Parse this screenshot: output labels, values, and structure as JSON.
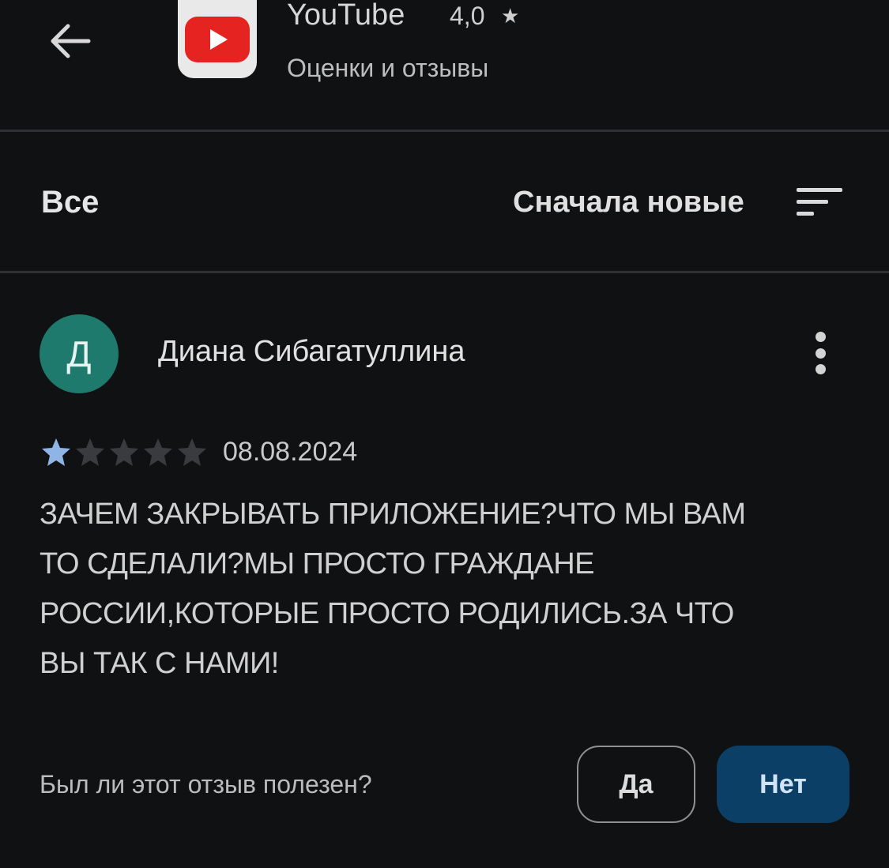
{
  "header": {
    "app_name": "YouTube",
    "rating": "4,0",
    "rating_star_glyph": "★",
    "subtitle": "Оценки и отзывы",
    "back_icon": "arrow-left-icon",
    "app_icon": "youtube-logo-icon"
  },
  "filters": {
    "all_label": "Все",
    "sort_label": "Сначала новые",
    "sort_icon": "sort-icon"
  },
  "review": {
    "avatar_letter": "Д",
    "author": "Диана Сибагатуллина",
    "rating": 1,
    "max_rating": 5,
    "date": "08.08.2024",
    "text": "ЗАЧЕМ ЗАКРЫВАТЬ ПРИЛОЖЕНИЕ?ЧТО МЫ ВАМ\nТО СДЕЛАЛИ?МЫ ПРОСТО ГРАЖДАНЕ\nРОССИИ,КОТОРЫЕ ПРОСТО РОДИЛИСЬ.ЗА ЧТО\nВЫ ТАК С НАМИ!",
    "more_icon": "more-vert-icon"
  },
  "helpful": {
    "question": "Был ли этот отзыв полезен?",
    "yes_label": "Да",
    "no_label": "Нет"
  },
  "colors": {
    "background": "#101113",
    "avatar": "#1f7a6e",
    "star_filled": "#8fb4e6",
    "star_empty": "#3a3b3e",
    "no_button": "#0c3f66",
    "youtube_red": "#e52421"
  }
}
